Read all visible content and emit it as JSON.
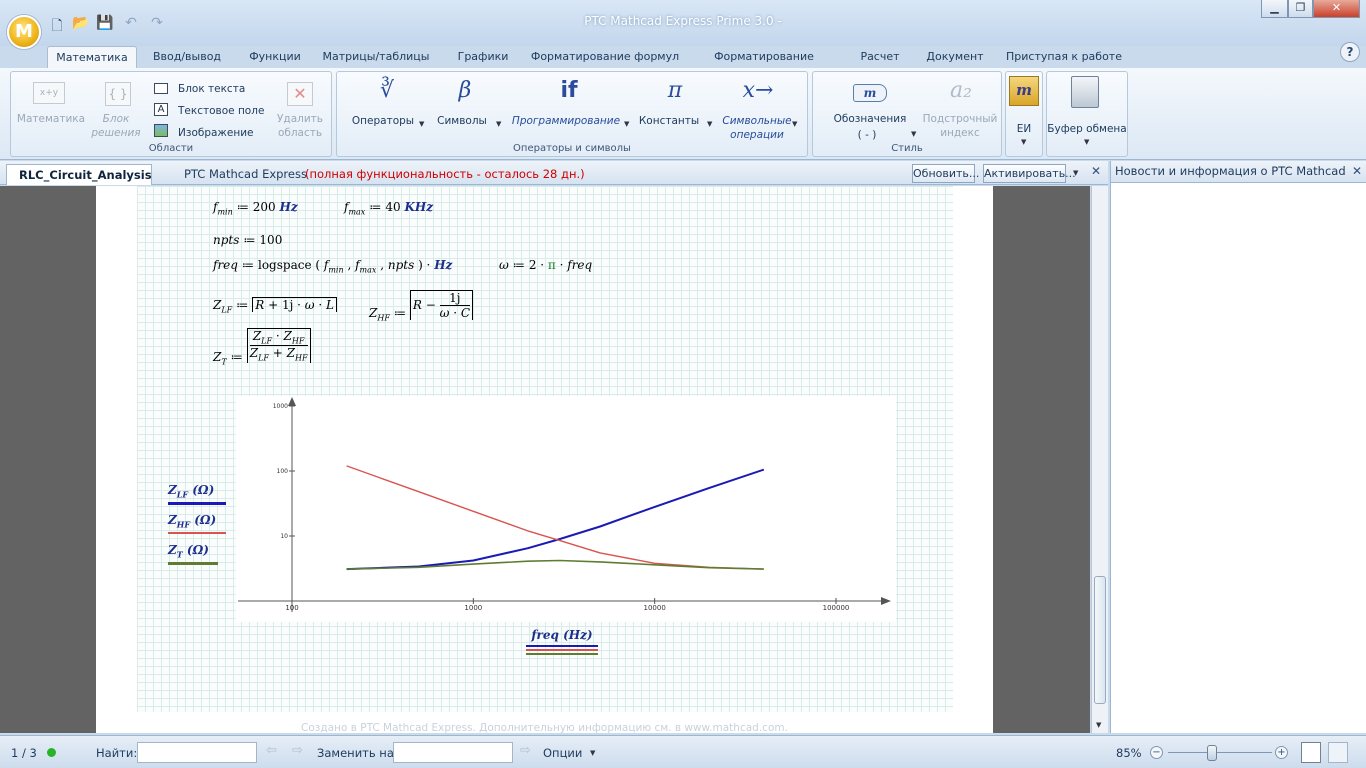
{
  "title": "PTC Mathcad Express Prime 3.0 -",
  "logo": "M",
  "tabs": [
    "Математика",
    "Ввод/вывод",
    "Функции",
    "Матрицы/таблицы",
    "Графики",
    "Форматирование формул",
    "Форматирование текста",
    "Расчет",
    "Документ",
    "Приступая к работе"
  ],
  "ribbon": {
    "regions": {
      "label": "Области",
      "math": "Математика",
      "block_solve": "Блок решения",
      "text_block": "Блок текста",
      "text_field": "Текстовое поле",
      "image": "Изображение",
      "delete_region": "Удалить область"
    },
    "operators": {
      "label": "Операторы и символы",
      "operators": "Операторы",
      "symbols": "Символы",
      "programming": "Программирование",
      "constants": "Константы",
      "symbolic": "Символьные операции"
    },
    "style": {
      "label": "Стиль",
      "labels": "Обозначения",
      "labels_value": "( - )",
      "subscript": "Подстрочный индекс"
    },
    "units": "ЕИ",
    "clipboard": "Буфер обмена"
  },
  "doc": {
    "tab": "RLC_Circuit_Analysis",
    "app_name": "PTC Mathcad Express",
    "trial": "(полная функциональность - осталось 28 дн.)",
    "update": "Обновить...",
    "activate": "Активировать..."
  },
  "right_panel": {
    "title": "Новости и информация о PTC Mathcad"
  },
  "footer": "Создано в PTC Mathcad Express. Дополнительную информацию см. в www.mathcad.com.",
  "status": {
    "page": "1 / 3",
    "find": "Найти:",
    "replace": "Заменить на:",
    "options": "Опции",
    "zoom": "85%"
  },
  "colors": {
    "zlf": "#1a1ab4",
    "zhf": "#d9534f",
    "zt": "#5f7d32",
    "accent": "#2a4c9a"
  },
  "chart_data": {
    "type": "line",
    "xscale": "log",
    "yscale": "log",
    "xlim": [
      100,
      100000
    ],
    "ylim": [
      1,
      1000
    ],
    "xticks": [
      "100",
      "1000",
      "10000",
      "100000"
    ],
    "yticks": [
      "1000",
      "100",
      "10"
    ],
    "xlabel": "freq (Hz)",
    "series": [
      {
        "name": "Z_LF (Ω)",
        "x": [
          200,
          500,
          1000,
          2000,
          3000,
          5000,
          10000,
          20000,
          40000
        ],
        "y": [
          3.1,
          3.4,
          4.2,
          6.5,
          9,
          14,
          28,
          55,
          105
        ]
      },
      {
        "name": "Z_HF (Ω)",
        "x": [
          200,
          500,
          1000,
          2000,
          3000,
          5000,
          10000,
          20000,
          40000
        ],
        "y": [
          120,
          48,
          24,
          12,
          8.5,
          5.5,
          3.8,
          3.3,
          3.1
        ]
      },
      {
        "name": "Z_T (Ω)",
        "x": [
          200,
          500,
          1000,
          2000,
          3000,
          5000,
          10000,
          20000,
          40000
        ],
        "y": [
          3.1,
          3.3,
          3.7,
          4.1,
          4.2,
          4,
          3.6,
          3.25,
          3.1
        ]
      }
    ]
  }
}
